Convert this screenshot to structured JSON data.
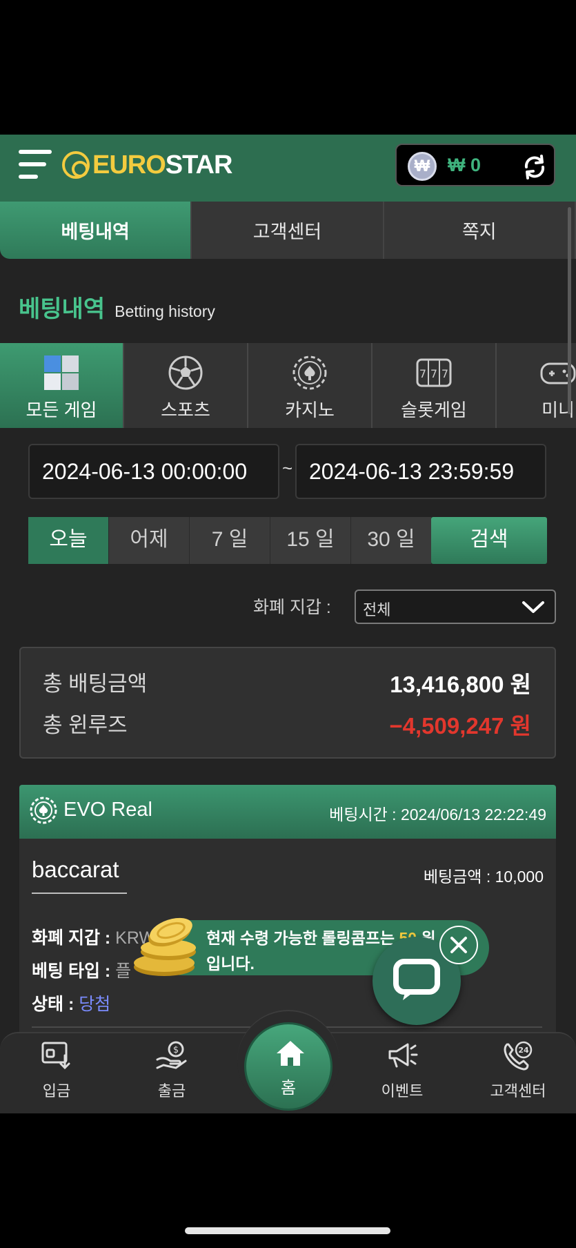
{
  "header": {
    "logo_prefix": "EURO",
    "logo_suffix": "STAR",
    "currency_symbol": "₩",
    "balance": "₩ 0"
  },
  "top_tabs": [
    {
      "label": "베팅내역",
      "active": true
    },
    {
      "label": "고객센터",
      "active": false
    },
    {
      "label": "쪽지",
      "active": false
    }
  ],
  "page_title": {
    "ko": "베팅내역",
    "en": "Betting history"
  },
  "categories": [
    {
      "label": "모든 게임",
      "icon": "all-games-icon",
      "active": true
    },
    {
      "label": "스포츠",
      "icon": "soccer-ball-icon",
      "active": false
    },
    {
      "label": "카지노",
      "icon": "casino-chip-icon",
      "active": false
    },
    {
      "label": "슬롯게임",
      "icon": "slot-machine-icon",
      "active": false
    },
    {
      "label": "미니",
      "icon": "gamepad-icon",
      "active": false
    }
  ],
  "date_filter": {
    "start": "2024-06-13 00:00:00",
    "separator": "~",
    "end": "2024-06-13 23:59:59"
  },
  "quick_ranges": [
    {
      "label": "오늘",
      "active": true
    },
    {
      "label": "어제",
      "active": false
    },
    {
      "label": "7 일",
      "active": false
    },
    {
      "label": "15 일",
      "active": false
    },
    {
      "label": "30 일",
      "active": false
    }
  ],
  "search_label": "검색",
  "wallet": {
    "label": "화폐 지갑 :",
    "selected": "전체"
  },
  "summary": {
    "total_bet_label": "총 배팅금액",
    "total_bet_value": "13,416,800 원",
    "winloss_label": "총 윈루즈",
    "winloss_value": "−4,509,247 원"
  },
  "bet": {
    "provider": "EVO Real",
    "time": "베팅시간 : 2024/06/13 22:22:49",
    "game": "baccarat",
    "amount": "베팅금액 : 10,000",
    "wallet_label": "화폐 지갑 :",
    "wallet_value": "KRW",
    "type_label": "베팅 타입 :",
    "type_value": "플",
    "status_label": "상태 :",
    "status_value": "당첨"
  },
  "popup": {
    "line1_pre": "현재 수령 가능한 롤링콤프는 ",
    "amount": "50",
    "line1_post": " 원",
    "line2": "입니다."
  },
  "bottom_nav": [
    {
      "label": "입금",
      "icon": "deposit-icon"
    },
    {
      "label": "출금",
      "icon": "withdraw-icon"
    },
    {
      "label": "홈",
      "icon": "home-icon"
    },
    {
      "label": "이벤트",
      "icon": "megaphone-icon"
    },
    {
      "label": "고객센터",
      "icon": "support-24-icon"
    }
  ],
  "colors": {
    "accent": "#2f7a59",
    "accent_light": "#48c48d",
    "negative": "#e2372d",
    "highlight": "#f3cb3f",
    "status_win": "#7b8cff"
  }
}
